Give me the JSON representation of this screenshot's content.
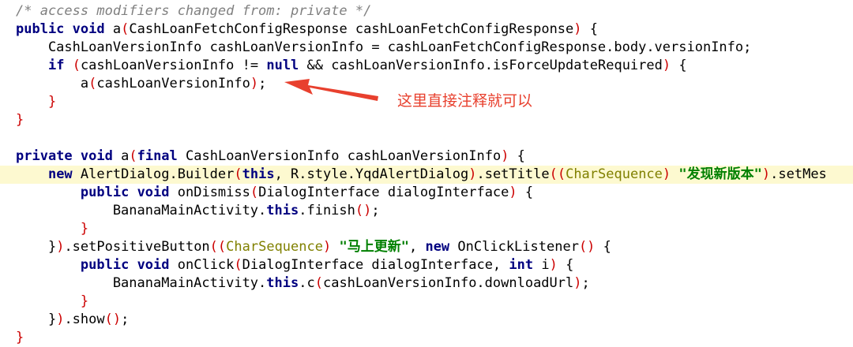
{
  "annotation": {
    "text": "这里直接注释就可以",
    "color": "#e8402e"
  },
  "colors": {
    "keyword": "#000080",
    "comment": "#808080",
    "string": "#008000",
    "type_cast": "#808000",
    "punctuation_highlight": "#cc0000",
    "line_highlight": "#fdf9d0"
  },
  "lines": [
    {
      "highlight": false,
      "tokens": [
        {
          "t": "/* access modifiers changed from: private */",
          "c": "cm"
        }
      ]
    },
    {
      "highlight": false,
      "tokens": [
        {
          "t": "public",
          "c": "kw"
        },
        {
          "t": " "
        },
        {
          "t": "void",
          "c": "kw"
        },
        {
          "t": " a"
        },
        {
          "t": "(",
          "c": "pn"
        },
        {
          "t": "CashLoanFetchConfigResponse cashLoanFetchConfigResponse"
        },
        {
          "t": ")",
          "c": "pn"
        },
        {
          "t": " {"
        }
      ]
    },
    {
      "highlight": false,
      "tokens": [
        {
          "t": "    CashLoanVersionInfo cashLoanVersionInfo = cashLoanFetchConfigResponse.body.versionInfo;"
        }
      ]
    },
    {
      "highlight": false,
      "tokens": [
        {
          "t": "    "
        },
        {
          "t": "if",
          "c": "kw"
        },
        {
          "t": " "
        },
        {
          "t": "(",
          "c": "pn"
        },
        {
          "t": "cashLoanVersionInfo != "
        },
        {
          "t": "null",
          "c": "kw"
        },
        {
          "t": " && cashLoanVersionInfo.isForceUpdateRequired"
        },
        {
          "t": ")",
          "c": "pn"
        },
        {
          "t": " {"
        }
      ]
    },
    {
      "highlight": false,
      "tokens": [
        {
          "t": "        a"
        },
        {
          "t": "(",
          "c": "pn"
        },
        {
          "t": "cashLoanVersionInfo"
        },
        {
          "t": ")",
          "c": "pn"
        },
        {
          "t": ";"
        }
      ]
    },
    {
      "highlight": false,
      "tokens": [
        {
          "t": "    }",
          "c": "pn"
        }
      ]
    },
    {
      "highlight": false,
      "tokens": [
        {
          "t": "}",
          "c": "pn"
        }
      ]
    },
    {
      "highlight": false,
      "tokens": []
    },
    {
      "highlight": false,
      "tokens": [
        {
          "t": "private",
          "c": "kw"
        },
        {
          "t": " "
        },
        {
          "t": "void",
          "c": "kw"
        },
        {
          "t": " a"
        },
        {
          "t": "(",
          "c": "pn"
        },
        {
          "t": "final",
          "c": "kw"
        },
        {
          "t": " CashLoanVersionInfo cashLoanVersionInfo"
        },
        {
          "t": ")",
          "c": "pn"
        },
        {
          "t": " {"
        }
      ]
    },
    {
      "highlight": true,
      "tokens": [
        {
          "t": "    "
        },
        {
          "t": "new",
          "c": "kw"
        },
        {
          "t": " AlertDialog.Builder"
        },
        {
          "t": "(",
          "c": "pn"
        },
        {
          "t": "this",
          "c": "kw"
        },
        {
          "t": ", R.style.YqdAlertDialog"
        },
        {
          "t": ")",
          "c": "pn"
        },
        {
          "t": ".setTitle"
        },
        {
          "t": "((",
          "c": "pn"
        },
        {
          "t": "CharSequence",
          "c": "ty"
        },
        {
          "t": ")",
          "c": "pn"
        },
        {
          "t": " "
        },
        {
          "t": "\"发现新版本\"",
          "c": "st"
        },
        {
          "t": ")",
          "c": "pn"
        },
        {
          "t": ".setMes"
        }
      ]
    },
    {
      "highlight": false,
      "tokens": [
        {
          "t": "        "
        },
        {
          "t": "public",
          "c": "kw"
        },
        {
          "t": " "
        },
        {
          "t": "void",
          "c": "kw"
        },
        {
          "t": " onDismiss"
        },
        {
          "t": "(",
          "c": "pn"
        },
        {
          "t": "DialogInterface dialogInterface"
        },
        {
          "t": ")",
          "c": "pn"
        },
        {
          "t": " {"
        }
      ]
    },
    {
      "highlight": false,
      "tokens": [
        {
          "t": "            BananaMainActivity."
        },
        {
          "t": "this",
          "c": "kw"
        },
        {
          "t": ".finish"
        },
        {
          "t": "()",
          "c": "pn"
        },
        {
          "t": ";"
        }
      ]
    },
    {
      "highlight": false,
      "tokens": [
        {
          "t": "        }",
          "c": "pn"
        }
      ]
    },
    {
      "highlight": false,
      "tokens": [
        {
          "t": "    }"
        },
        {
          "t": ")",
          "c": "pn"
        },
        {
          "t": ".setPositiveButton"
        },
        {
          "t": "((",
          "c": "pn"
        },
        {
          "t": "CharSequence",
          "c": "ty"
        },
        {
          "t": ")",
          "c": "pn"
        },
        {
          "t": " "
        },
        {
          "t": "\"马上更新\"",
          "c": "st"
        },
        {
          "t": ", "
        },
        {
          "t": "new",
          "c": "kw"
        },
        {
          "t": " OnClickListener"
        },
        {
          "t": "()",
          "c": "pn"
        },
        {
          "t": " {"
        }
      ]
    },
    {
      "highlight": false,
      "tokens": [
        {
          "t": "        "
        },
        {
          "t": "public",
          "c": "kw"
        },
        {
          "t": " "
        },
        {
          "t": "void",
          "c": "kw"
        },
        {
          "t": " onClick"
        },
        {
          "t": "(",
          "c": "pn"
        },
        {
          "t": "DialogInterface dialogInterface, "
        },
        {
          "t": "int",
          "c": "kw"
        },
        {
          "t": " i"
        },
        {
          "t": ")",
          "c": "pn"
        },
        {
          "t": " {"
        }
      ]
    },
    {
      "highlight": false,
      "tokens": [
        {
          "t": "            BananaMainActivity."
        },
        {
          "t": "this",
          "c": "kw"
        },
        {
          "t": ".c"
        },
        {
          "t": "(",
          "c": "pn"
        },
        {
          "t": "cashLoanVersionInfo.downloadUrl"
        },
        {
          "t": ")",
          "c": "pn"
        },
        {
          "t": ";"
        }
      ]
    },
    {
      "highlight": false,
      "tokens": [
        {
          "t": "        }",
          "c": "pn"
        }
      ]
    },
    {
      "highlight": false,
      "tokens": [
        {
          "t": "    }"
        },
        {
          "t": ")",
          "c": "pn"
        },
        {
          "t": ".show"
        },
        {
          "t": "()",
          "c": "pn"
        },
        {
          "t": ";"
        }
      ]
    },
    {
      "highlight": false,
      "tokens": [
        {
          "t": "}",
          "c": "pn"
        }
      ]
    }
  ]
}
